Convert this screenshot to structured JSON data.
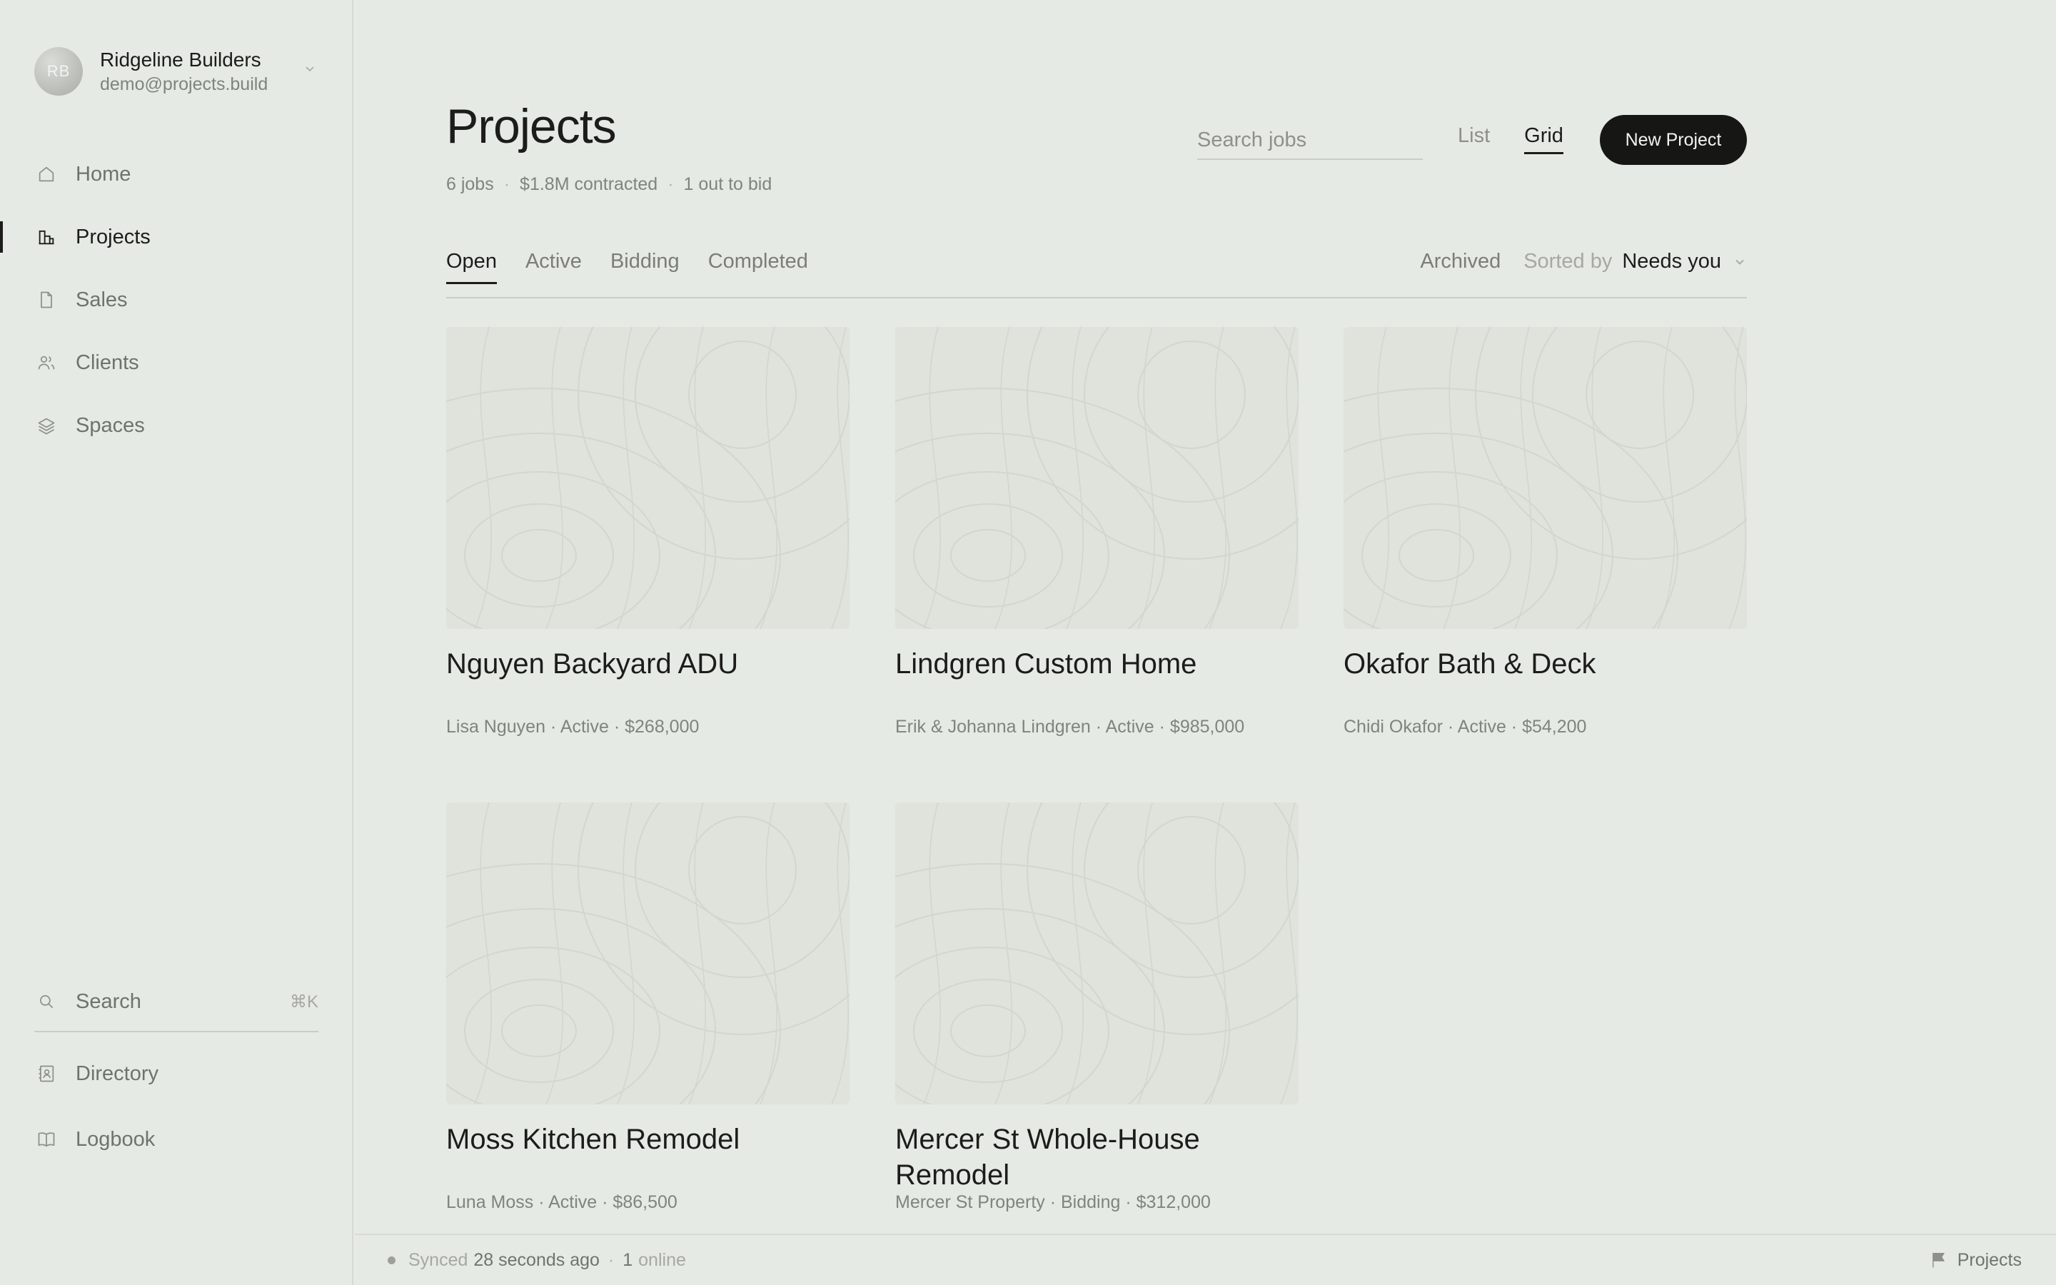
{
  "account": {
    "initials": "RB",
    "name": "Ridgeline Builders",
    "email": "demo@projects.build"
  },
  "nav": {
    "items": [
      {
        "label": "Home",
        "icon": "home-icon"
      },
      {
        "label": "Projects",
        "icon": "projects-icon",
        "active": true
      },
      {
        "label": "Sales",
        "icon": "document-icon"
      },
      {
        "label": "Clients",
        "icon": "people-icon"
      },
      {
        "label": "Spaces",
        "icon": "layers-icon"
      }
    ],
    "search_label": "Search",
    "search_shortcut": "⌘K",
    "bottom": [
      {
        "label": "Directory",
        "icon": "contact-book-icon"
      },
      {
        "label": "Logbook",
        "icon": "book-icon"
      }
    ]
  },
  "header": {
    "title": "Projects",
    "summary": [
      "6 jobs",
      "$1.8M contracted",
      "1 out to bid"
    ],
    "search_placeholder": "Search jobs",
    "views": [
      "List",
      "Grid"
    ],
    "active_view": "Grid",
    "new_button": "New Project"
  },
  "tabs": {
    "items": [
      "Open",
      "Active",
      "Bidding",
      "Completed"
    ],
    "active": "Open",
    "archived": "Archived",
    "sorted_label": "Sorted by",
    "sort_value": "Needs you"
  },
  "projects": [
    {
      "title": "Nguyen Backyard ADU",
      "meta": "Lisa Nguyen · Active · $268,000"
    },
    {
      "title": "Lindgren Custom Home",
      "meta": "Erik & Johanna Lindgren · Active · $985,000"
    },
    {
      "title": "Okafor Bath & Deck",
      "meta": "Chidi Okafor · Active · $54,200"
    },
    {
      "title": "Moss Kitchen Remodel",
      "meta": "Luna Moss · Active · $86,500"
    },
    {
      "title": "Mercer St Whole-House Remodel",
      "meta": "Mercer St Property · Bidding · $312,000"
    }
  ],
  "status": {
    "synced_label": "Synced",
    "synced_time": "28 seconds ago",
    "online_count": "1",
    "online_label": "online",
    "right_label": "Projects"
  },
  "colors": {
    "background": "#e6eae4",
    "text": "#1c1d1b",
    "muted": "#80847e",
    "button": "#161714",
    "thumbnail": "#dfe3dc"
  }
}
